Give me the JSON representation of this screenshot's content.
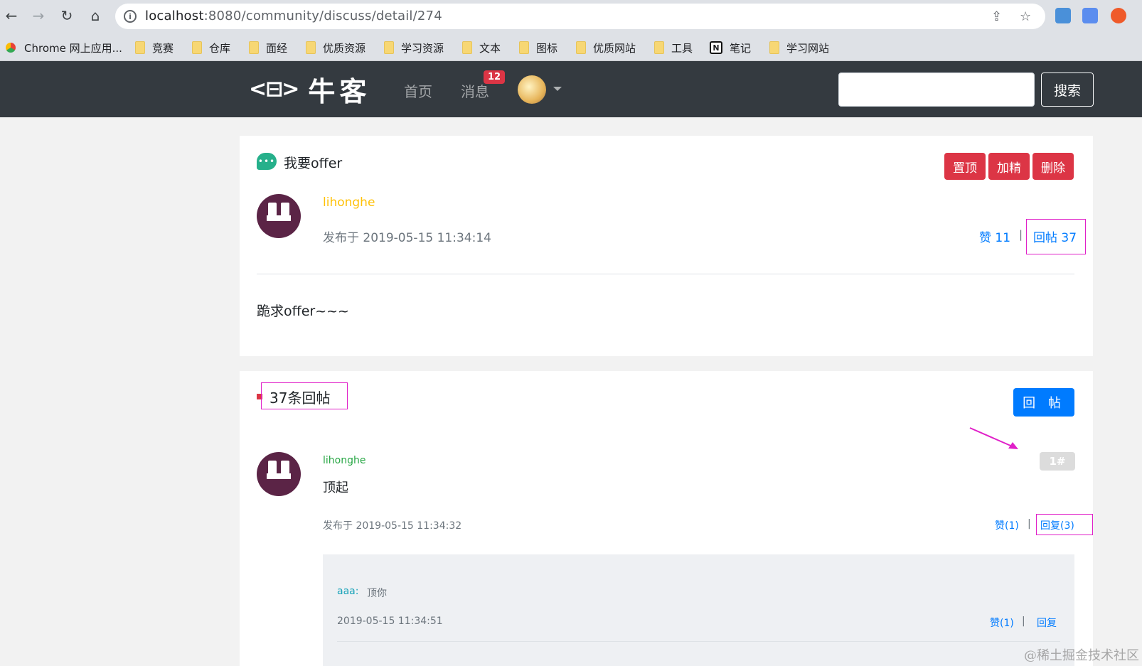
{
  "browser": {
    "url_host": "localhost",
    "url_path": ":8080/community/discuss/detail/274",
    "bookmarks": [
      "Chrome 网上应用...",
      "竞赛",
      "仓库",
      "面经",
      "优质资源",
      "学习资源",
      "文本",
      "图标",
      "优质网站",
      "工具",
      "笔记",
      "学习网站"
    ]
  },
  "header": {
    "logo_text": "牛客",
    "nav": {
      "home": "首页",
      "messages": "消息",
      "message_count": "12"
    },
    "search_button": "搜索"
  },
  "post": {
    "title": "我要offer",
    "admin_buttons": {
      "top": "置顶",
      "wonderful": "加精",
      "delete": "删除"
    },
    "author": "lihonghe",
    "published": "发布于 2019-05-15 11:34:14",
    "like": "赞 11",
    "reply_count": "回帖 37",
    "content": "跪求offer~~~"
  },
  "replies": {
    "title": "37条回帖",
    "reply_button": "回 帖",
    "items": [
      {
        "floor": "1#",
        "author": "lihonghe",
        "content": "顶起",
        "published": "发布于 2019-05-15 11:34:32",
        "like": "赞(1)",
        "reply": "回复(3)",
        "sub": {
          "author": "aaa:",
          "text": "顶你",
          "date": "2019-05-15 11:34:51",
          "like": "赞(1)",
          "reply": "回复"
        }
      }
    ]
  },
  "watermark": "@稀土掘金技术社区",
  "colors": {
    "danger": "#dc3545",
    "primary": "#007bff",
    "header_bg": "#343a40",
    "highlight": "#e020c8"
  }
}
